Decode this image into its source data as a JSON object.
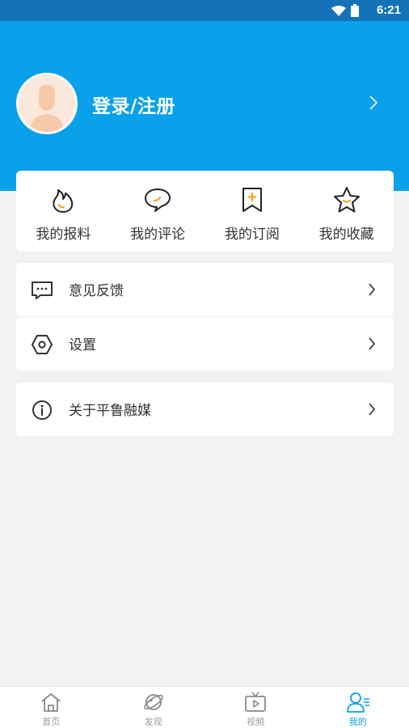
{
  "status_bar": {
    "time": "6:21"
  },
  "header": {
    "login_label": "登录/注册"
  },
  "quick_actions": [
    {
      "label": "我的报料",
      "icon": "flame-icon"
    },
    {
      "label": "我的评论",
      "icon": "comment-icon"
    },
    {
      "label": "我的订阅",
      "icon": "bookmark-plus-icon"
    },
    {
      "label": "我的收藏",
      "icon": "star-icon"
    }
  ],
  "menu": {
    "feedback": {
      "label": "意见反馈",
      "icon": "message-dots-icon"
    },
    "settings": {
      "label": "设置",
      "icon": "settings-hexagon-icon"
    },
    "about": {
      "label": "关于平鲁融媒",
      "icon": "info-icon"
    }
  },
  "tabbar": [
    {
      "label": "首页",
      "icon": "home-icon",
      "active": false
    },
    {
      "label": "发现",
      "icon": "planet-icon",
      "active": false
    },
    {
      "label": "视频",
      "icon": "tv-play-icon",
      "active": false
    },
    {
      "label": "我的",
      "icon": "user-icon",
      "active": true
    }
  ],
  "colors": {
    "header_blue": "#0aa0ea",
    "status_bar": "#1473b8",
    "accent_orange": "#f5a623",
    "background": "#f2f2f2",
    "active_tab": "#0aa0ea"
  }
}
